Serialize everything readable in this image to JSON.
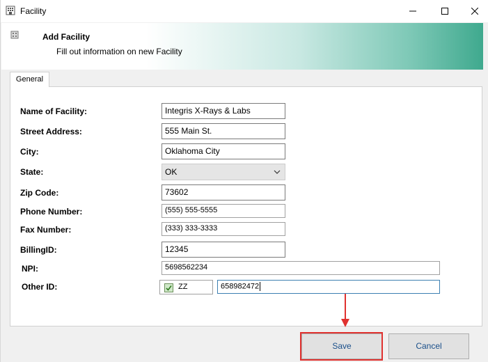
{
  "window": {
    "title": "Facility",
    "icon": "building-icon",
    "controls": {
      "minimize": "minimize-icon",
      "maximize": "maximize-icon",
      "close": "close-icon"
    }
  },
  "banner": {
    "title": "Add Facility",
    "subtitle": "Fill out information on new Facility",
    "icon": "building-icon"
  },
  "tabs": [
    {
      "label": "General",
      "selected": true
    }
  ],
  "form": {
    "name_label": "Name of Facility:",
    "name_value": "Integris X-Rays & Labs",
    "street_label": "Street Address:",
    "street_value": "555 Main St.",
    "city_label": "City:",
    "city_value": "Oklahoma City",
    "state_label": "State:",
    "state_value": "OK",
    "zip_label": "Zip Code:",
    "zip_value": "73602",
    "phone_label": "Phone Number:",
    "phone_value": "(555) 555-5555",
    "fax_label": "Fax Number:",
    "fax_value": "(333) 333-3333",
    "billing_label": "BillingID:",
    "billing_value": "12345",
    "npi_label": "NPI:",
    "npi_value": "5698562234",
    "other_label": "Other ID:",
    "other_checkbox_label": "ZZ",
    "other_checked": true,
    "other_value": "658982472"
  },
  "buttons": {
    "save": "Save",
    "cancel": "Cancel"
  },
  "colors": {
    "annotation": "#e0312f",
    "banner_accent": "#3fa98e",
    "button_text": "#1a4f8a"
  }
}
